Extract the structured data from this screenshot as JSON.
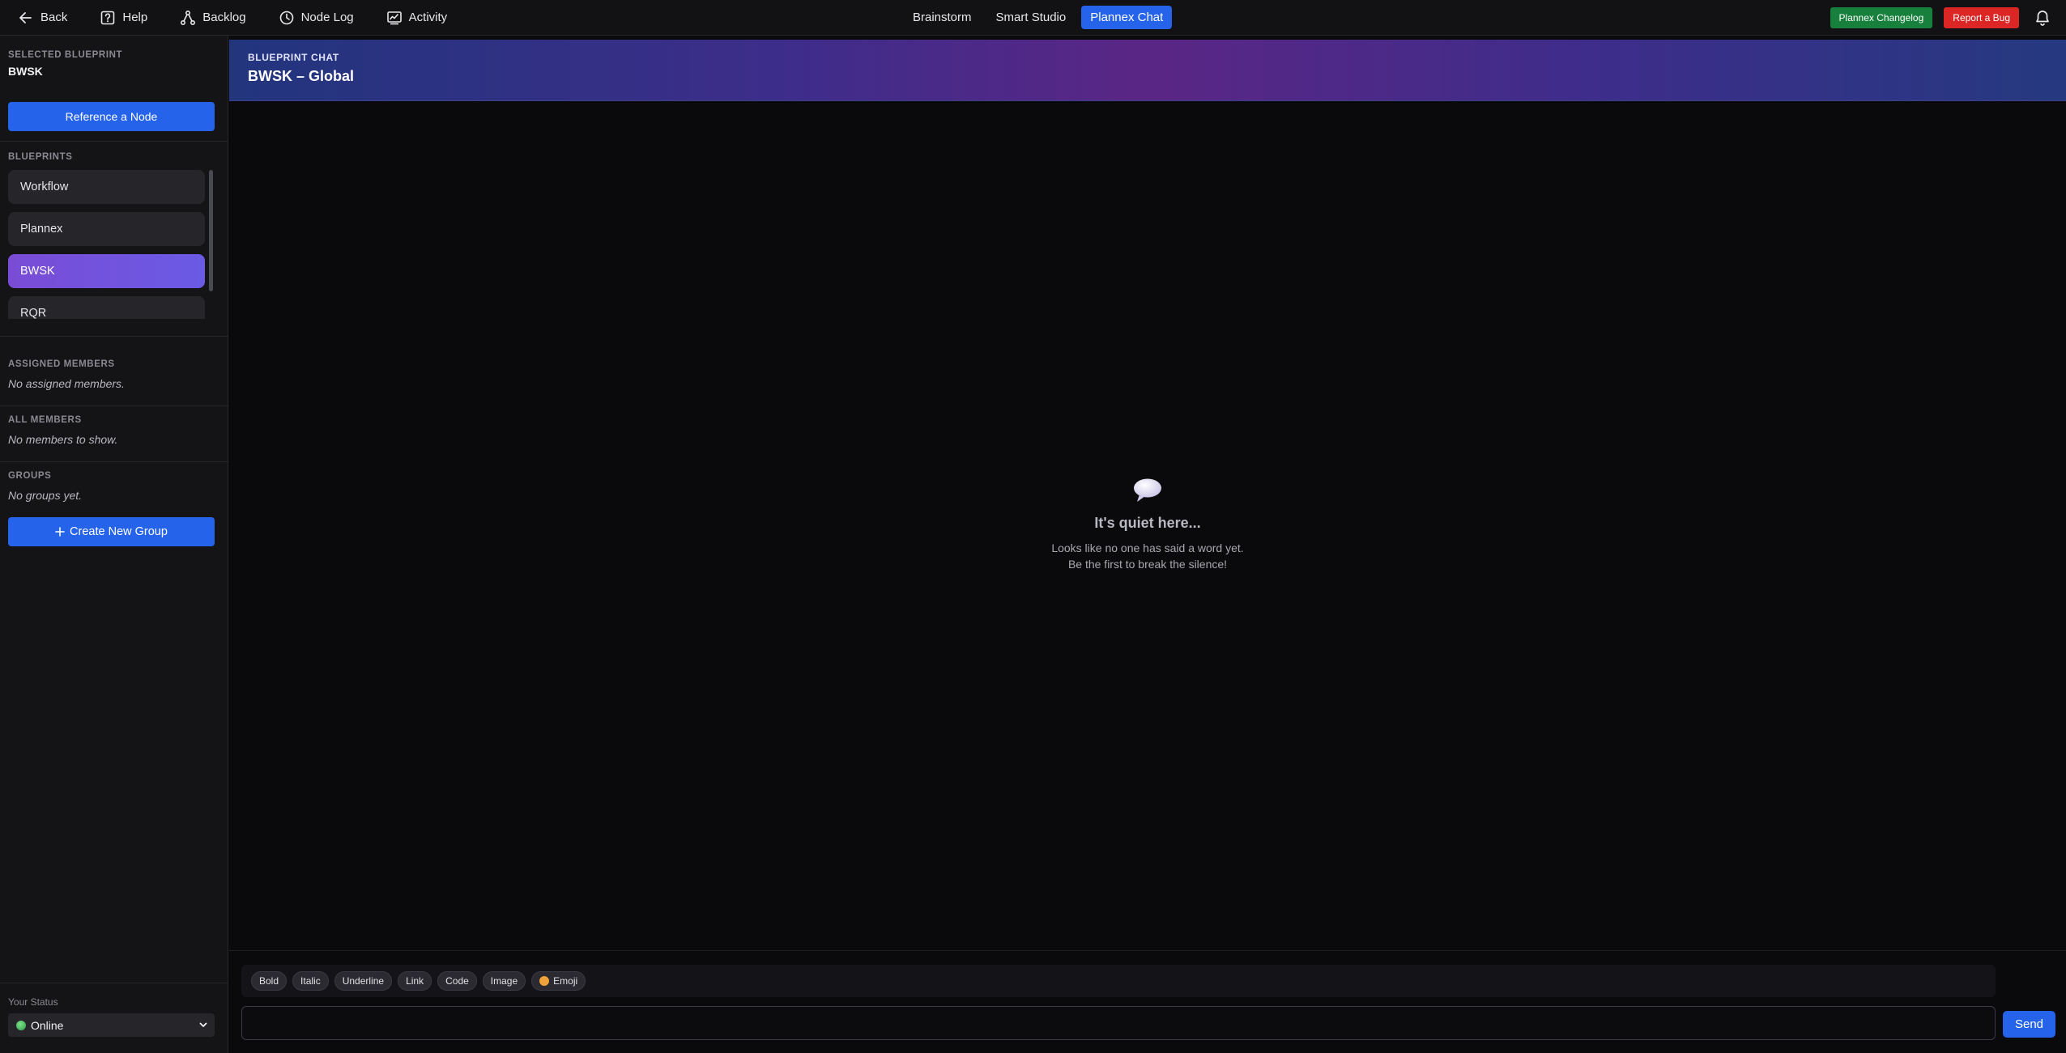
{
  "topbar": {
    "left_nav": [
      {
        "label": "Back",
        "icon": "arrow-left-icon"
      },
      {
        "label": "Help",
        "icon": "help-icon"
      },
      {
        "label": "Backlog",
        "icon": "graph-icon"
      },
      {
        "label": "Node Log",
        "icon": "clock-icon"
      },
      {
        "label": "Activity",
        "icon": "activity-icon"
      }
    ],
    "center_tabs": [
      {
        "label": "Brainstorm",
        "active": false
      },
      {
        "label": "Smart Studio",
        "active": false
      },
      {
        "label": "Plannex Chat",
        "active": true
      }
    ],
    "changelog_label": "Plannex Changelog",
    "bug_label": "Report a Bug",
    "notification_icon": "bell-icon"
  },
  "sidebar": {
    "selected_label": "SELECTED BLUEPRINT",
    "selected_name": "BWSK",
    "reference_button": "Reference a Node",
    "blueprints_label": "BLUEPRINTS",
    "blueprints": [
      {
        "label": "Workflow",
        "active": false
      },
      {
        "label": "Plannex",
        "active": false
      },
      {
        "label": "BWSK",
        "active": true
      },
      {
        "label": "RQR",
        "active": false
      }
    ],
    "assigned_label": "ASSIGNED MEMBERS",
    "assigned_empty": "No assigned members.",
    "all_label": "ALL MEMBERS",
    "all_empty": "No members to show.",
    "groups_label": "GROUPS",
    "groups_empty": "No groups yet.",
    "create_group_button": "Create New Group",
    "status_label": "Your Status",
    "status_value": "Online"
  },
  "chat": {
    "kicker": "BLUEPRINT CHAT",
    "title": "BWSK – Global",
    "empty_title": "It's quiet here...",
    "empty_line1": "Looks like no one has said a word yet.",
    "empty_line2": "Be the first to break the silence!"
  },
  "composer": {
    "format_buttons": [
      "Bold",
      "Italic",
      "Underline",
      "Link",
      "Code",
      "Image"
    ],
    "emoji_label": "Emoji",
    "input_value": "",
    "send_label": "Send"
  },
  "colors": {
    "accent": "#2563eb",
    "active_blueprint": "#7a4cd6",
    "changelog": "#16803c",
    "report_bug": "#dc2626",
    "background": "#0a0a0c",
    "sidebar": "#141416"
  }
}
